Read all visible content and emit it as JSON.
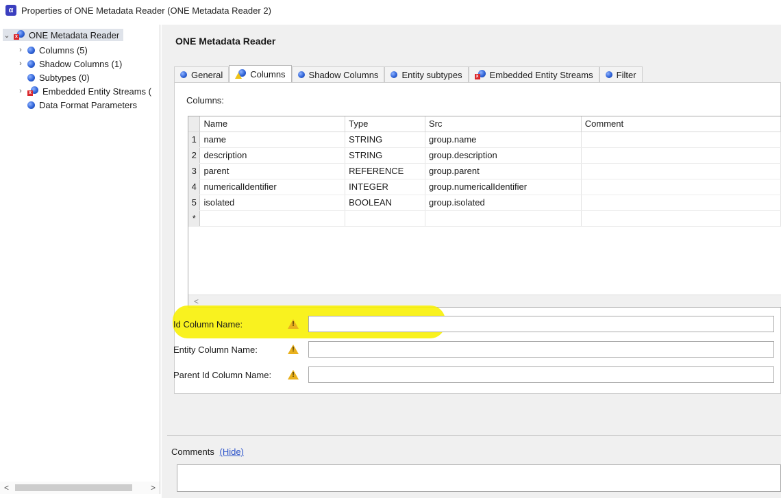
{
  "window": {
    "title": "Properties of ONE Metadata Reader (ONE Metadata Reader 2)",
    "app_icon_glyph": "α"
  },
  "tree": {
    "root": "ONE Metadata Reader",
    "items": [
      {
        "label": "Columns (5)",
        "expandable": true
      },
      {
        "label": "Shadow Columns (1)",
        "expandable": true
      },
      {
        "label": "Subtypes (0)",
        "expandable": false
      },
      {
        "label": "Embedded Entity Streams (",
        "expandable": true
      },
      {
        "label": "Data Format Parameters",
        "expandable": false
      }
    ],
    "scroll_left": "<",
    "scroll_right": ">"
  },
  "main": {
    "title": "ONE Metadata Reader",
    "tabs": [
      {
        "label": "General",
        "icon": "blue-dot-icon"
      },
      {
        "label": "Columns",
        "icon": "warning-component-icon",
        "active": true
      },
      {
        "label": "Shadow Columns",
        "icon": "blue-dot-icon"
      },
      {
        "label": "Entity subtypes",
        "icon": "blue-dot-icon"
      },
      {
        "label": "Embedded Entity Streams",
        "icon": "error-component-icon"
      },
      {
        "label": "Filter",
        "icon": "blue-dot-icon"
      }
    ],
    "columns_label": "Columns:",
    "table": {
      "headers": [
        "Name",
        "Type",
        "Src",
        "Comment"
      ],
      "rows": [
        {
          "num": "1",
          "name": "name",
          "type": "STRING",
          "src": "group.name",
          "comment": ""
        },
        {
          "num": "2",
          "name": "description",
          "type": "STRING",
          "src": "group.description",
          "comment": ""
        },
        {
          "num": "3",
          "name": "parent",
          "type": "REFERENCE",
          "src": "group.parent",
          "comment": ""
        },
        {
          "num": "4",
          "name": "numericalIdentifier",
          "type": "INTEGER",
          "src": "group.numericalIdentifier",
          "comment": ""
        },
        {
          "num": "5",
          "name": "isolated",
          "type": "BOOLEAN",
          "src": "group.isolated",
          "comment": ""
        }
      ],
      "new_row_marker": "*",
      "scroll_left": "<"
    },
    "fields": [
      {
        "label": "Id Column Name:",
        "value": ""
      },
      {
        "label": "Entity Column Name:",
        "value": ""
      },
      {
        "label": "Parent Id Column Name:",
        "value": ""
      }
    ],
    "highlight_color": "#f8f000"
  },
  "comments": {
    "label": "Comments",
    "hide_link": "(Hide)",
    "value": ""
  }
}
